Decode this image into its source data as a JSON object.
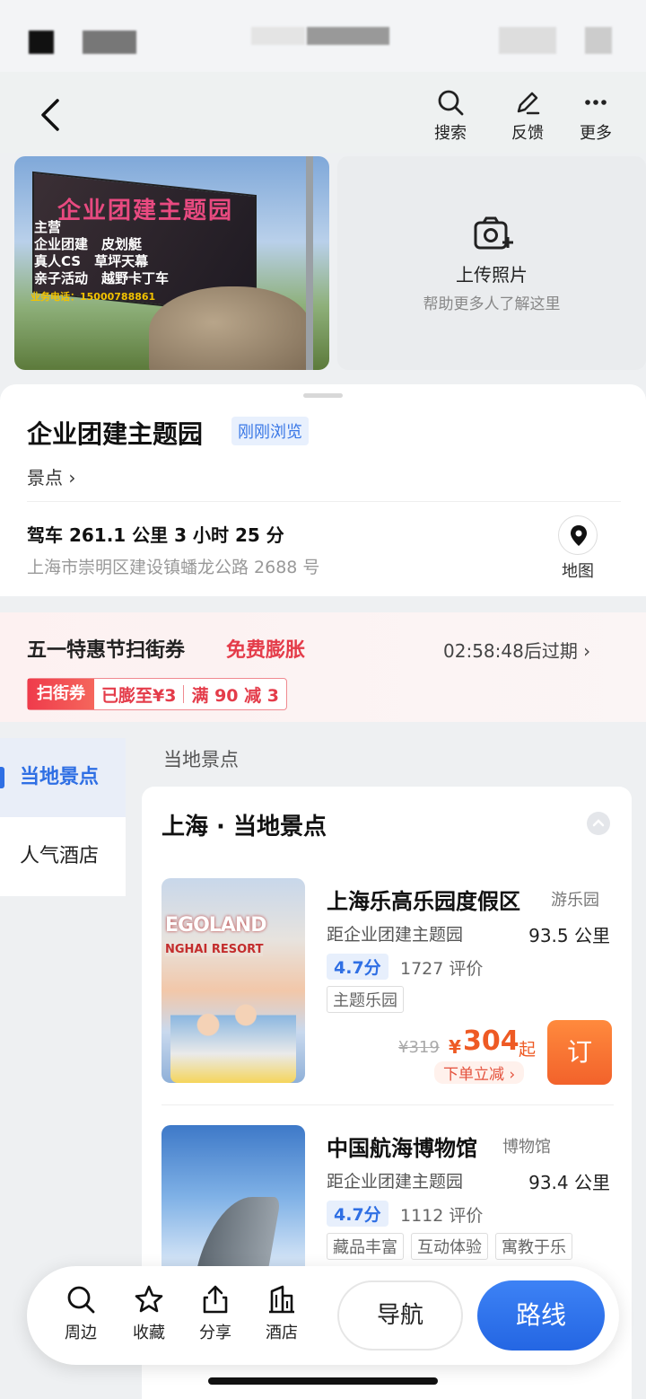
{
  "header": {
    "search_label": "搜索",
    "feedback_label": "反馈",
    "more_label": "更多"
  },
  "photo": {
    "sign_title": "企业团建主题园",
    "sign_lines": [
      "主营",
      "企业团建　皮划艇",
      "真人CS　草坪天幕",
      "亲子活动　越野卡丁车"
    ],
    "sign_phone": "业务电话：15000788861"
  },
  "upload": {
    "title": "上传照片",
    "subtitle": "帮助更多人了解这里"
  },
  "poi": {
    "name": "企业团建主题园",
    "badge": "刚刚浏览",
    "type": "景点 ›",
    "drive": "驾车 261.1 公里 3 小时 25 分",
    "address": "上海市崇明区建设镇蟠龙公路 2688 号",
    "map_label": "地图"
  },
  "promo": {
    "title": "五一特惠节扫街券",
    "free": "免费膨胀",
    "timer": "02:58:48后过期 ›",
    "coupon_tag": "扫街券",
    "coupon_amount": "已膨至¥3",
    "coupon_rule": "满 90 减 3"
  },
  "sidebar": {
    "items": [
      {
        "label": "当地景点",
        "active": true
      },
      {
        "label": "人气酒店",
        "active": false
      }
    ]
  },
  "section": {
    "label": "当地景点",
    "card_title": "上海 · 当地景点"
  },
  "items": [
    {
      "name": "上海乐高乐园度假区",
      "category": "游乐园",
      "dist_label": "距企业团建主题园",
      "distance": "93.5 公里",
      "score": "4.7分",
      "reviews": "1727 评价",
      "tags": [
        "主题乐园"
      ],
      "orig_price": "¥319",
      "yen": "¥",
      "price": "304",
      "price_suffix": "起",
      "discount": "下单立减 ›",
      "order": "订",
      "thumb_text": "EGOLAND",
      "thumb_sub": "NGHAI RESORT"
    },
    {
      "name": "中国航海博物馆",
      "category": "博物馆",
      "dist_label": "距企业团建主题园",
      "distance": "93.4 公里",
      "score": "4.7分",
      "reviews": "1112 评价",
      "tags": [
        "藏品丰富",
        "互动体验",
        "寓教于乐"
      ]
    }
  ],
  "bottombar": {
    "nearby": "周边",
    "favorite": "收藏",
    "share": "分享",
    "hotel": "酒店",
    "navigate": "导航",
    "route": "路线"
  },
  "colors": {
    "accent_blue": "#2f6fe4",
    "price_orange": "#ee5a24",
    "promo_red": "#e43c4a"
  }
}
